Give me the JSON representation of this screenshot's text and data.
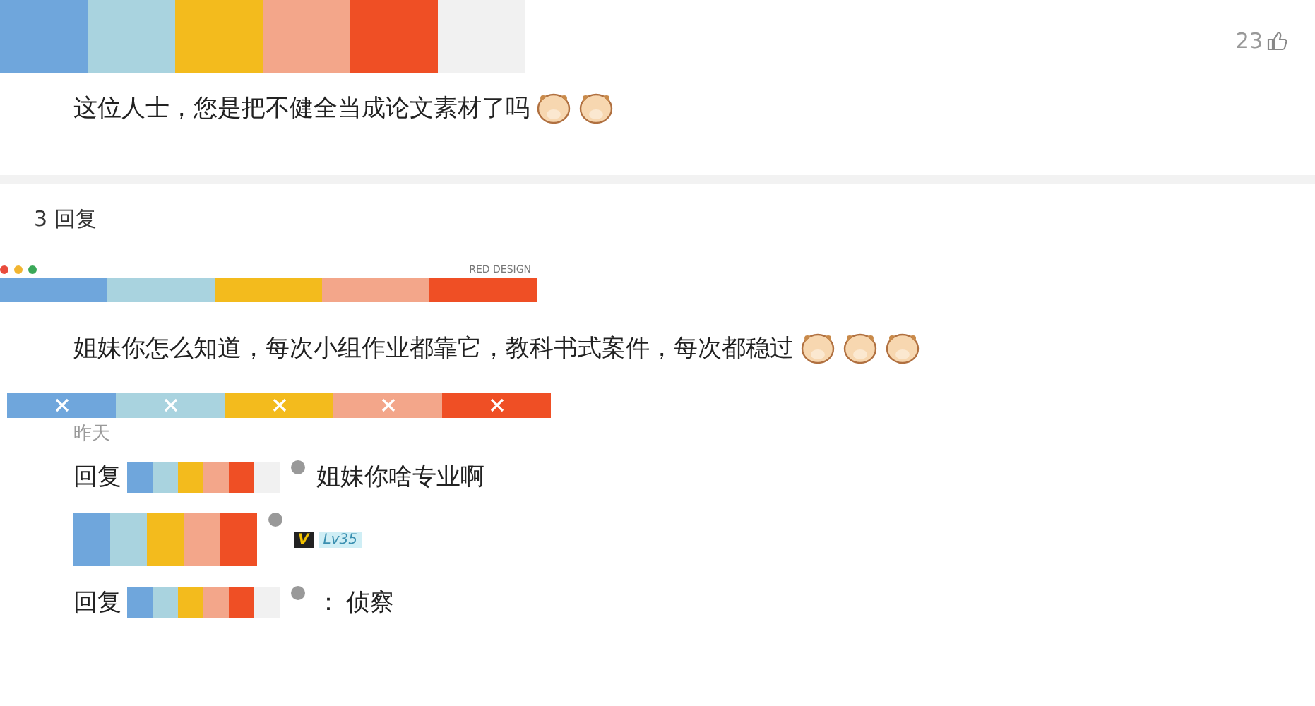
{
  "palette": [
    {
      "color": "#6fa6dc"
    },
    {
      "color": "#a9d3df"
    },
    {
      "color": "#f3bb1d"
    },
    {
      "color": "#f3a68a"
    },
    {
      "color": "#ef4f25"
    },
    {
      "color": "#f1f1f1"
    }
  ],
  "comment": {
    "likes": "23",
    "text": "这位人士，您是把不健全当成论文素材了吗",
    "emojis": [
      {
        "kind": "emoji"
      },
      {
        "kind": "emoji"
      }
    ]
  },
  "replies_header": "3 回复",
  "sticker": {
    "label": "RED DESIGN"
  },
  "replies": [
    {
      "kind": "plain",
      "text": "姐妹你怎么知道，每次小组作业都靠它，教科书式案件，每次都稳过",
      "emojis": [
        {
          "kind": "emoji"
        },
        {
          "kind": "emoji"
        },
        {
          "kind": "emoji"
        }
      ]
    },
    {
      "kind": "reply_to",
      "time": "昨天",
      "prefix": "回复",
      "text": "姐妹你啥专业啊"
    },
    {
      "kind": "reply_to",
      "badges": {
        "vip": "V",
        "level": "Lv35"
      },
      "prefix": "回复",
      "separator": "：",
      "text": "侦察"
    }
  ]
}
